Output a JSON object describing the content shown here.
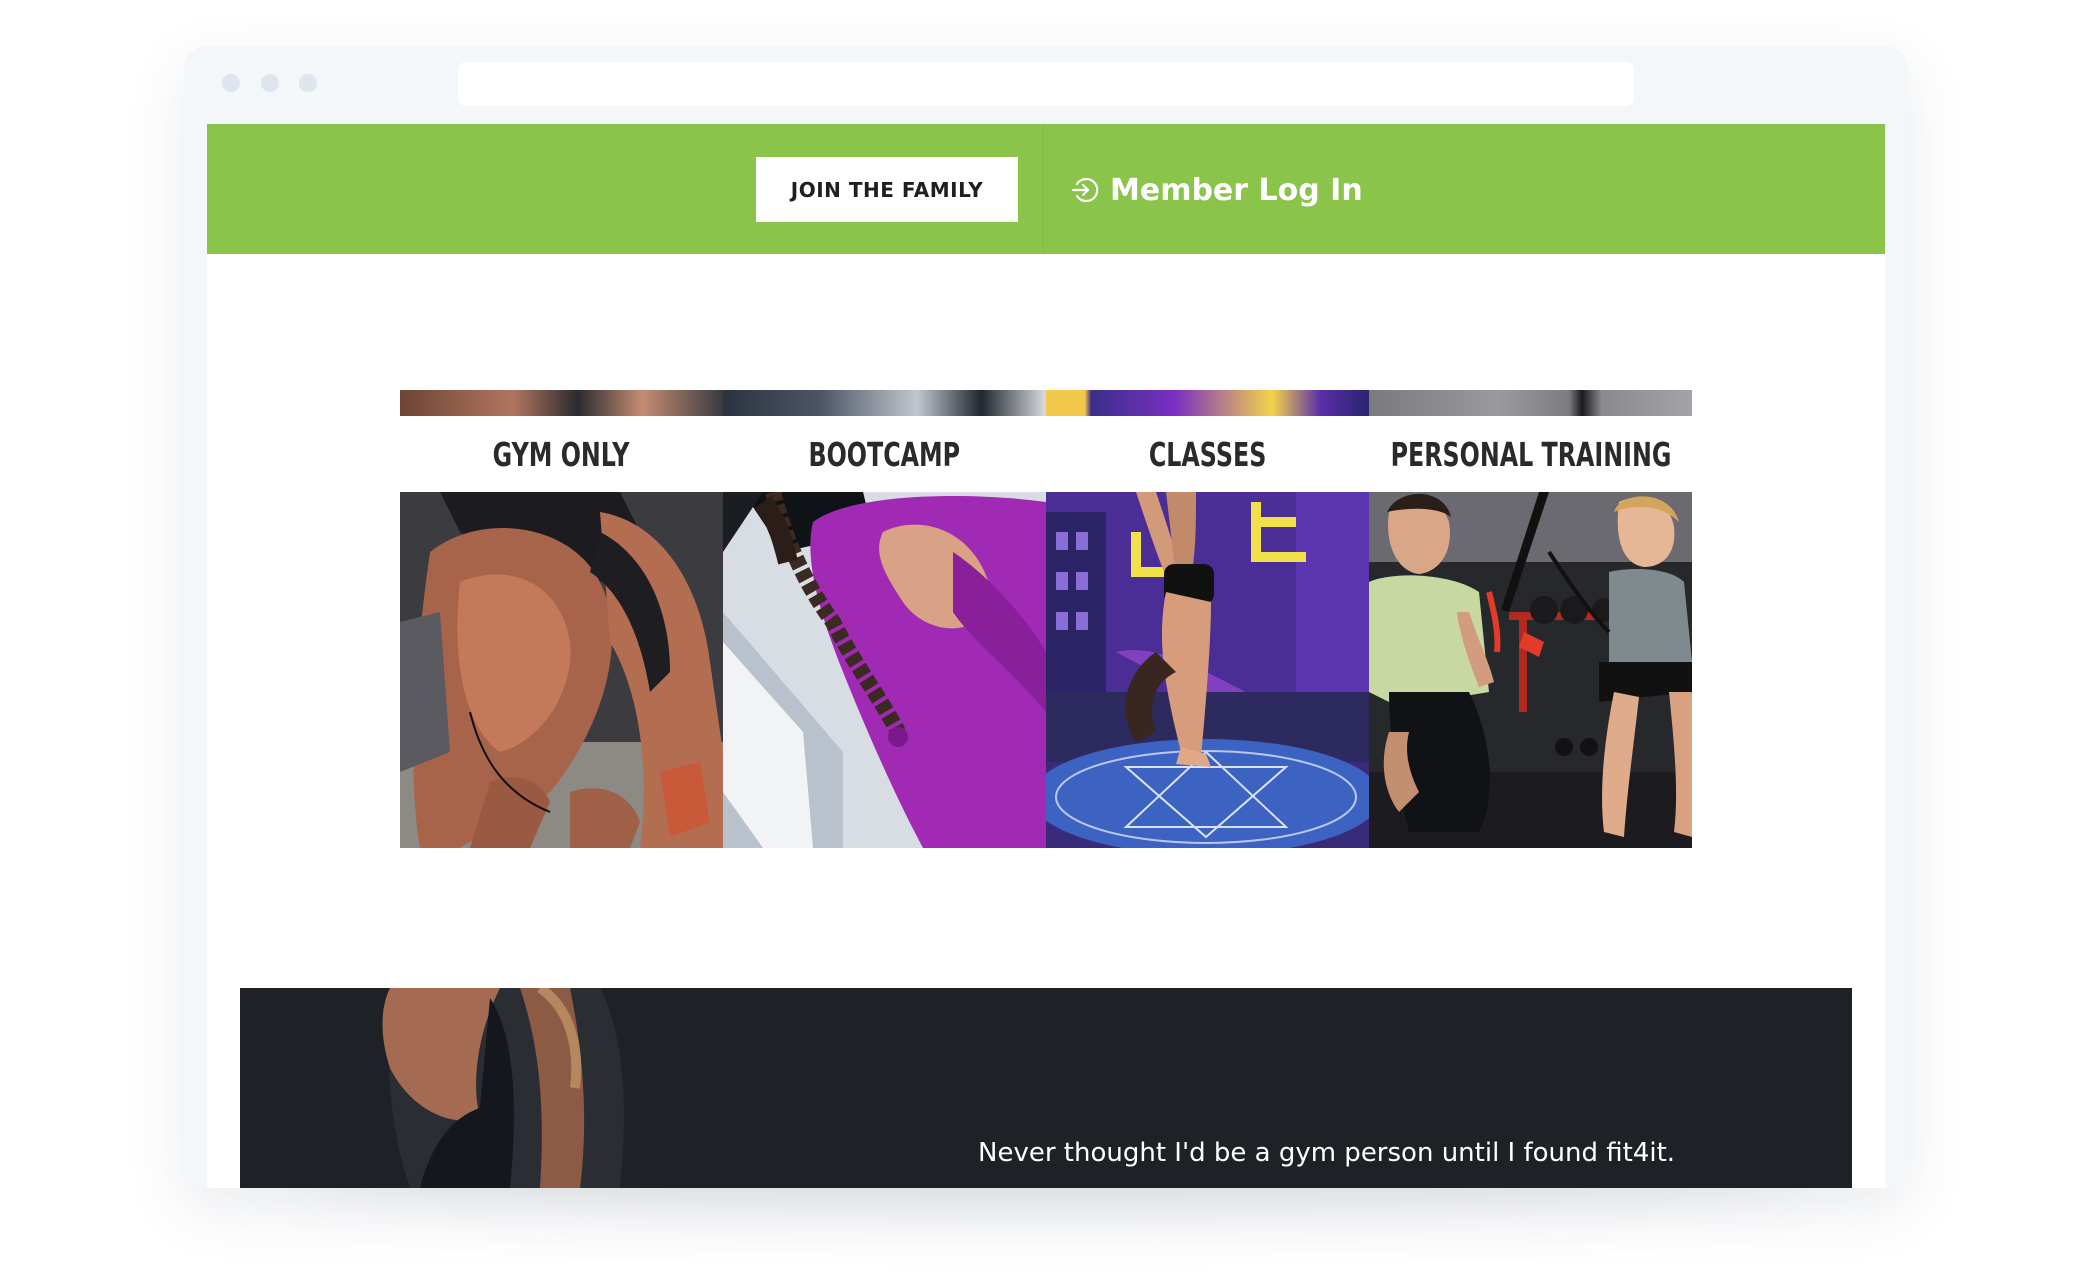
{
  "header": {
    "join_label": "JOIN THE FAMILY",
    "login_label": "Member Log In",
    "login_icon": "login-arrow-icon",
    "accent_color": "#8ac44b"
  },
  "programs": [
    {
      "label": "GYM ONLY",
      "image": "muscular-man-tying-shoe-photo"
    },
    {
      "label": "BOOTCAMP",
      "image": "woman-braid-purple-shirt-photo"
    },
    {
      "label": "CLASSES",
      "image": "woman-handstand-mural-photo"
    },
    {
      "label": "PERSONAL TRAINING",
      "image": "trainer-and-client-gym-photo"
    }
  ],
  "testimonial": {
    "quote": "Never thought I'd be a gym person until I found fit4it.",
    "background_color": "#1e2227"
  }
}
